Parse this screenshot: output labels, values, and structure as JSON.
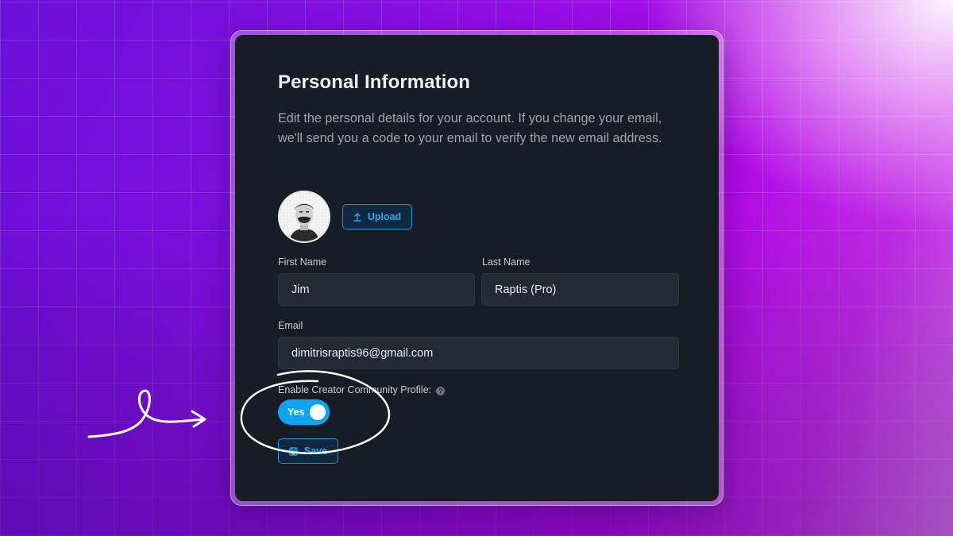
{
  "section": {
    "title": "Personal Information",
    "description": "Edit the personal details for your account. If you change your email, we'll send you a code to your email to verify the new email address."
  },
  "avatar": {
    "upload_label": "Upload",
    "upload_icon": "upload-icon"
  },
  "form": {
    "first_name": {
      "label": "First Name",
      "value": "Jim"
    },
    "last_name": {
      "label": "Last Name",
      "value": "Raptis (Pro)"
    },
    "email": {
      "label": "Email",
      "value": "dimitrisraptis96@gmail.com"
    },
    "creator_profile": {
      "label": "Enable Creator Community Profile:",
      "help_icon": "question-icon",
      "toggle_label": "Yes",
      "enabled": true
    }
  },
  "actions": {
    "save_label": "Save",
    "save_icon": "floppy-disk-icon"
  },
  "colors": {
    "accent": "#0ea5f0",
    "card_bg": "#181c24",
    "field_bg": "#252935"
  }
}
